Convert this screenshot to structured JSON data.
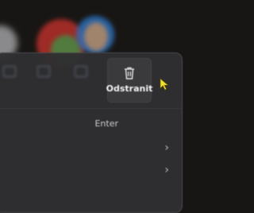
{
  "context_menu": {
    "toolbar": {
      "delete": {
        "label": "Odstranit",
        "icon": "trash-icon"
      }
    },
    "items": [
      {
        "shortcut": "Enter"
      },
      {
        "submenu": true
      },
      {
        "submenu": true
      }
    ]
  },
  "icons": {
    "chevron": "›",
    "cursor": "pointer-cursor-icon"
  },
  "colors": {
    "menu_bg": "#2f2f31",
    "cursor": "#f0e030",
    "text": "#f2f2f2"
  }
}
